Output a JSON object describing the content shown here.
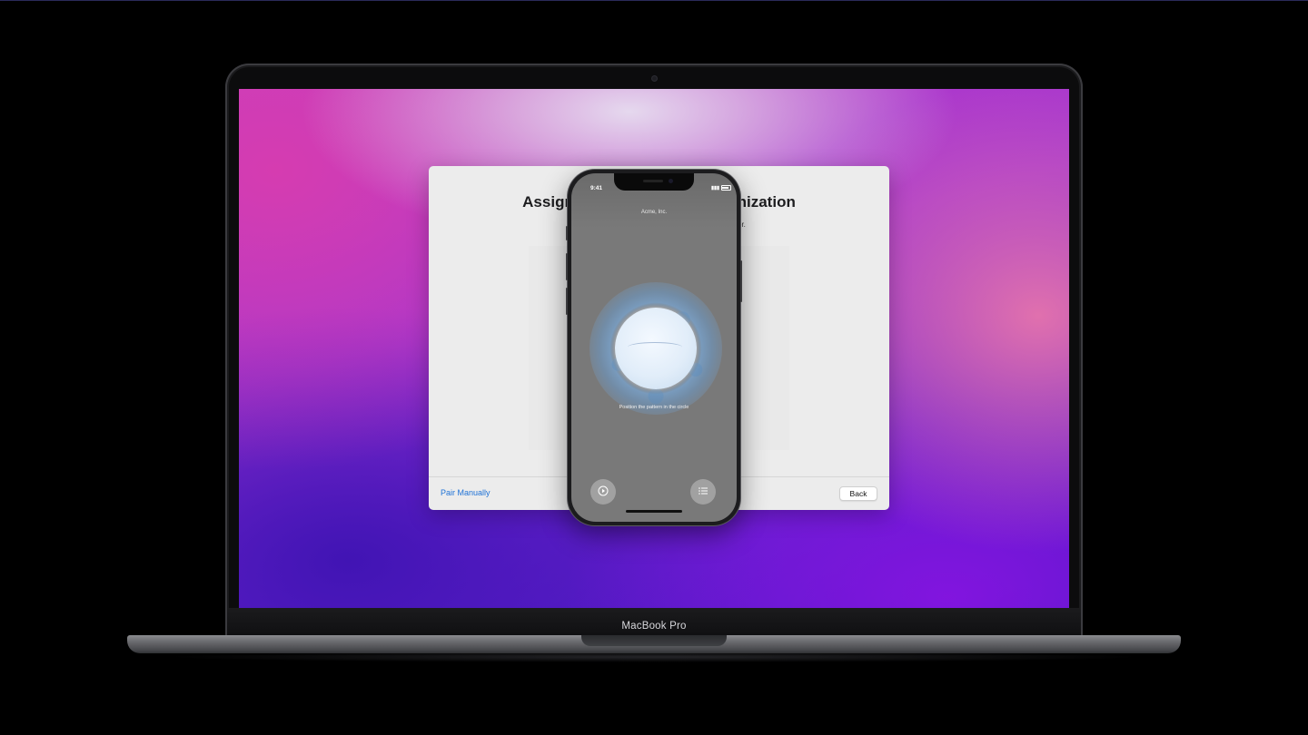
{
  "device": {
    "laptop_model": "MacBook Pro"
  },
  "setup_window": {
    "title": "Assign this Mac to Your Organization",
    "subtitle": "Position this image in the frame of Apple Configurator.",
    "pair_manually_label": "Pair Manually",
    "back_label": "Back"
  },
  "phone": {
    "status_time": "9:41",
    "organization": "Acme, Inc.",
    "pattern_hint": "Position the pattern in the circle",
    "left_button_icon": "play-circle-icon",
    "right_button_icon": "list-icon"
  },
  "colors": {
    "link": "#1f72d6",
    "window_bg": "#ececec",
    "wallpaper_pink": "#c03fc4",
    "wallpaper_purple": "#4d18c6"
  }
}
